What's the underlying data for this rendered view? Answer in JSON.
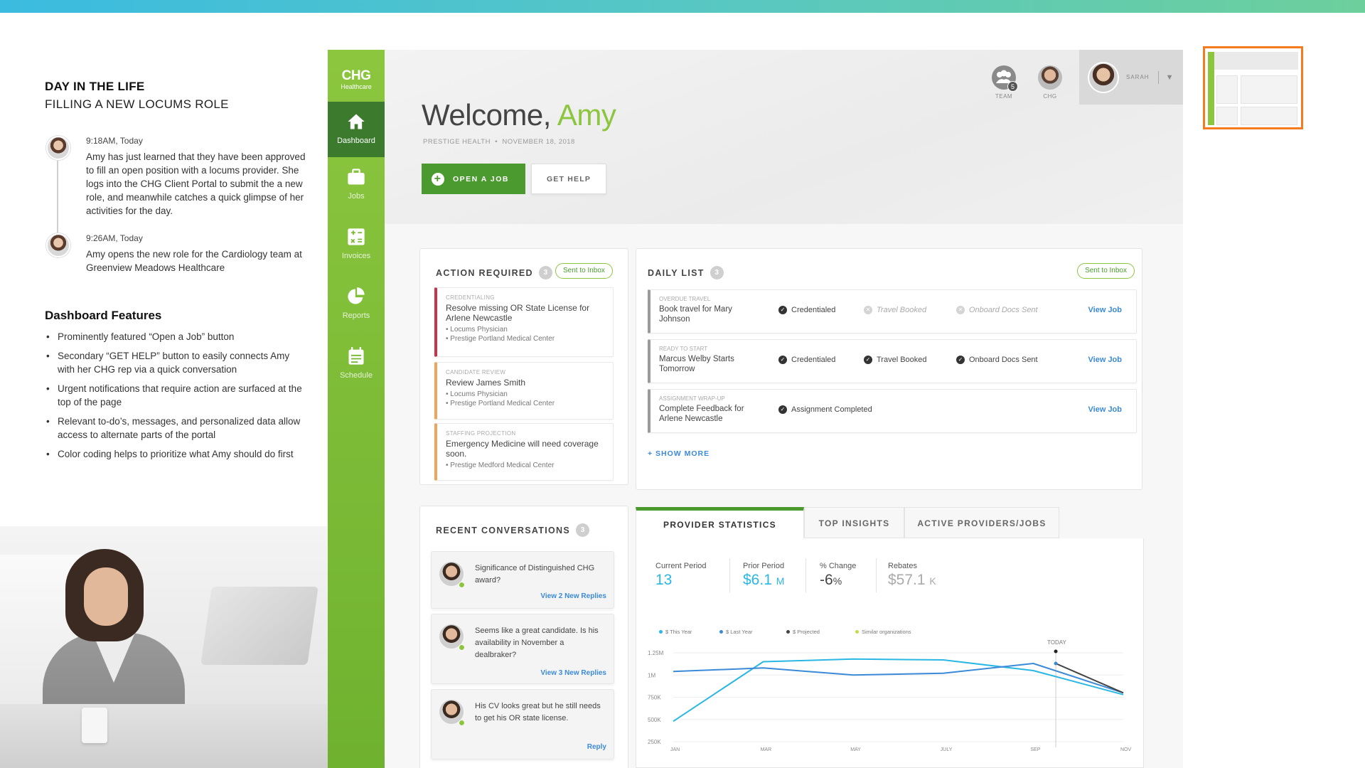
{
  "story": {
    "title": "DAY IN THE LIFE",
    "subtitle": "FILLING A NEW LOCUMS ROLE",
    "timeline": [
      {
        "time": "9:18AM, Today",
        "text": "Amy has just learned that they have been approved to fill an open position with a locums provider. She logs into the CHG Client Portal to submit the a new role, and meanwhile catches a quick glimpse of her activities for the day."
      },
      {
        "time": "9:26AM, Today",
        "text": "Amy opens the new role for the Cardiology team at Greenview Meadows Healthcare"
      }
    ],
    "features_title": "Dashboard Features",
    "features": [
      "Prominently featured “Open a Job” button",
      "Secondary “GET HELP” button to easily connects Amy with her CHG rep via a quick conversation",
      "Urgent notifications that require action are surfaced at the top of the page",
      "Relevant to-do’s, messages, and personalized data allow access to alternate parts of the portal",
      "Color coding helps to prioritize what Amy should do first"
    ]
  },
  "nav": {
    "logo": "CHG",
    "logo_sub": "Healthcare",
    "items": [
      {
        "label": "Dashboard",
        "icon": "home-icon"
      },
      {
        "label": "Jobs",
        "icon": "briefcase-icon"
      },
      {
        "label": "Invoices",
        "icon": "calculator-icon"
      },
      {
        "label": "Reports",
        "icon": "pie-chart-icon"
      },
      {
        "label": "Schedule",
        "icon": "calendar-icon"
      }
    ]
  },
  "header": {
    "welcome": "Welcome,",
    "name": "Amy",
    "org": "PRESTIGE HEALTH",
    "date": "NOVEMBER 18, 2018",
    "open_job": "OPEN A JOB",
    "get_help": "GET HELP",
    "team_label": "TEAM",
    "team_count": "5",
    "chg_label": "CHG",
    "user_name": "SARAH"
  },
  "action_required": {
    "title": "ACTION REQUIRED",
    "count": "3",
    "sent": "Sent to Inbox",
    "items": [
      {
        "category": "CREDENTIALING",
        "title": "Resolve missing OR State License for Arlene Newcastle",
        "sub1": "• Locums Physician",
        "sub2": "• Prestige Portland Medical Center",
        "color": "#c8334a"
      },
      {
        "category": "CANDIDATE REVIEW",
        "title": "Review James Smith",
        "sub1": "• Locums Physician",
        "sub2": "• Prestige Portland Medical Center",
        "color": "#f0a35a"
      },
      {
        "category": "STAFFING PROJECTION",
        "title": "Emergency Medicine will need coverage soon.",
        "sub1": "• Prestige Medford Medical Center",
        "sub2": "",
        "color": "#f0a35a"
      }
    ]
  },
  "daily_list": {
    "title": "DAILY LIST",
    "count": "3",
    "sent": "Sent to Inbox",
    "show_more": "+ SHOW MORE",
    "rows": [
      {
        "category": "OVERDUE TRAVEL",
        "title": "Book travel for Mary Johnson",
        "s1": "Credentialed",
        "s2": "Travel Booked",
        "s3": "Onboard Docs Sent",
        "link": "View Job"
      },
      {
        "category": "READY TO START",
        "title": "Marcus Welby Starts Tomorrow",
        "s1": "Credentialed",
        "s2": "Travel Booked",
        "s3": "Onboard Docs Sent",
        "link": "View Job"
      },
      {
        "category": "ASSIGNMENT WRAP-UP",
        "title": "Complete Feedback for Arlene Newcastle",
        "s1": "Assignment Completed",
        "link": "View Job"
      }
    ]
  },
  "conversations": {
    "title": "RECENT CONVERSATIONS",
    "count": "3",
    "items": [
      {
        "text": "Significance of Distinguished CHG award?",
        "link": "View 2 New Replies"
      },
      {
        "text": "Seems like a great candidate. Is his availability in November a dealbraker?",
        "link": "View 3 New Replies"
      },
      {
        "text": "His CV looks great but he still needs to get his OR state license.",
        "link": "Reply"
      }
    ]
  },
  "stats": {
    "tabs": [
      "PROVIDER STATISTICS",
      "TOP INSIGHTS",
      "ACTIVE PROVIDERS/JOBS"
    ],
    "current_label": "Current Period",
    "current_value": "13",
    "prior_label": "Prior Period",
    "prior_value": "$6.1",
    "prior_unit": "M",
    "change_label": "% Change",
    "change_value": "-6",
    "change_unit": "%",
    "rebates_label": "Rebates",
    "rebates_value": "$57.1",
    "rebates_unit": "K",
    "colors": {
      "blue": "#3b8ad8",
      "green": "#8cc63f",
      "cyan": "#2bb7e3",
      "dark": "#444444"
    }
  },
  "chart_data": {
    "type": "line",
    "x": [
      "JAN",
      "MAR",
      "MAY",
      "JULY",
      "SEP",
      "NOV"
    ],
    "yticks": [
      "1.25M",
      "1M",
      "750K",
      "500K",
      "250K"
    ],
    "ylim": [
      250000,
      1250000
    ],
    "today_label": "TODAY",
    "today_x": 8.5,
    "series": [
      {
        "name": "$ This Year",
        "color": "#2bb7e3",
        "points": [
          [
            0,
            480000
          ],
          [
            2,
            1150000
          ],
          [
            4,
            1180000
          ],
          [
            6,
            1170000
          ],
          [
            8,
            1050000
          ],
          [
            10,
            780000
          ]
        ]
      },
      {
        "name": "$ Last Year",
        "color": "#3b8ad8",
        "points": [
          [
            0,
            1040000
          ],
          [
            2,
            1080000
          ],
          [
            4,
            1000000
          ],
          [
            6,
            1020000
          ],
          [
            8,
            1130000
          ],
          [
            10,
            800000
          ]
        ]
      },
      {
        "name": "$ Projected",
        "color": "#444444",
        "points": [
          [
            8.5,
            1130000
          ],
          [
            10,
            800000
          ]
        ]
      },
      {
        "name": "Similar organizations",
        "color": "#c8d94a",
        "points": []
      }
    ]
  }
}
